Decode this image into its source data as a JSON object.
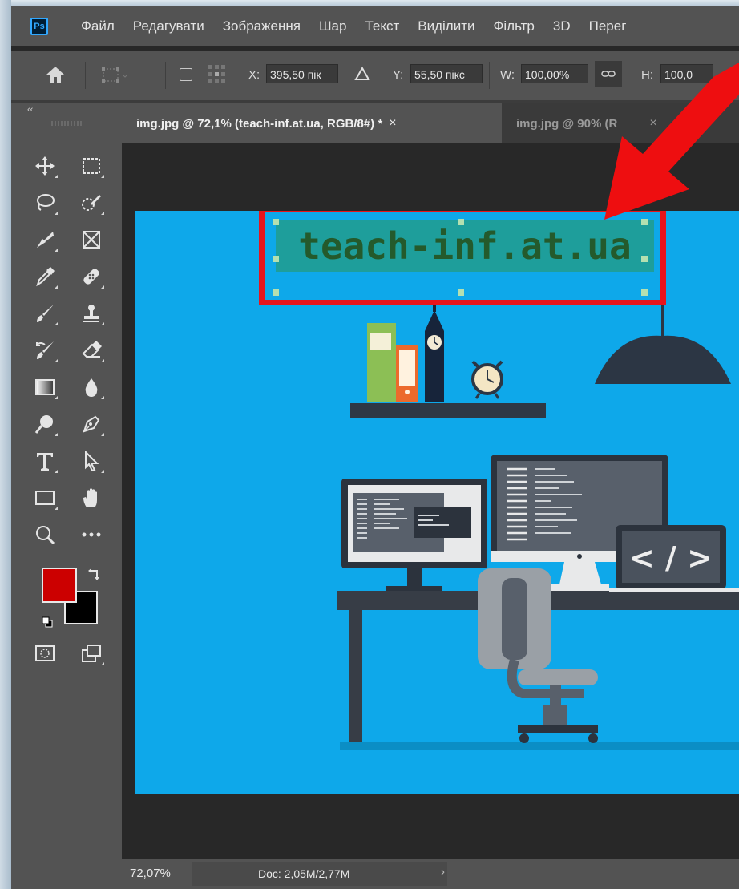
{
  "app": {
    "logo_text": "Ps"
  },
  "menu": [
    "Файл",
    "Редагувати",
    "Зображення",
    "Шар",
    "Текст",
    "Виділити",
    "Фільтр",
    "3D",
    "Перег"
  ],
  "options": {
    "x_label": "X:",
    "x_value": "395,50 пік",
    "y_label": "Y:",
    "y_value": "55,50 пікс",
    "w_label": "W:",
    "w_value": "100,00%",
    "h_label": "H:",
    "h_value": "100,0"
  },
  "tabs": [
    {
      "label": "img.jpg @ 72,1% (teach-inf.at.ua, RGB/8#) *",
      "close": "×"
    },
    {
      "label": "img.jpg @ 90% (R",
      "close": "×"
    }
  ],
  "toolbar": {
    "collapse": "‹‹"
  },
  "canvas": {
    "text_layer": "teach-inf.at.ua",
    "code_sign": "< / >"
  },
  "status": {
    "zoom": "72,07%",
    "doc": "Doc: 2,05M/2,77M",
    "chevron": "›"
  },
  "colors": {
    "foreground": "#cc0000",
    "background": "#000000",
    "highlight": "#e8141c",
    "image_bg": "#0ea8ea"
  }
}
